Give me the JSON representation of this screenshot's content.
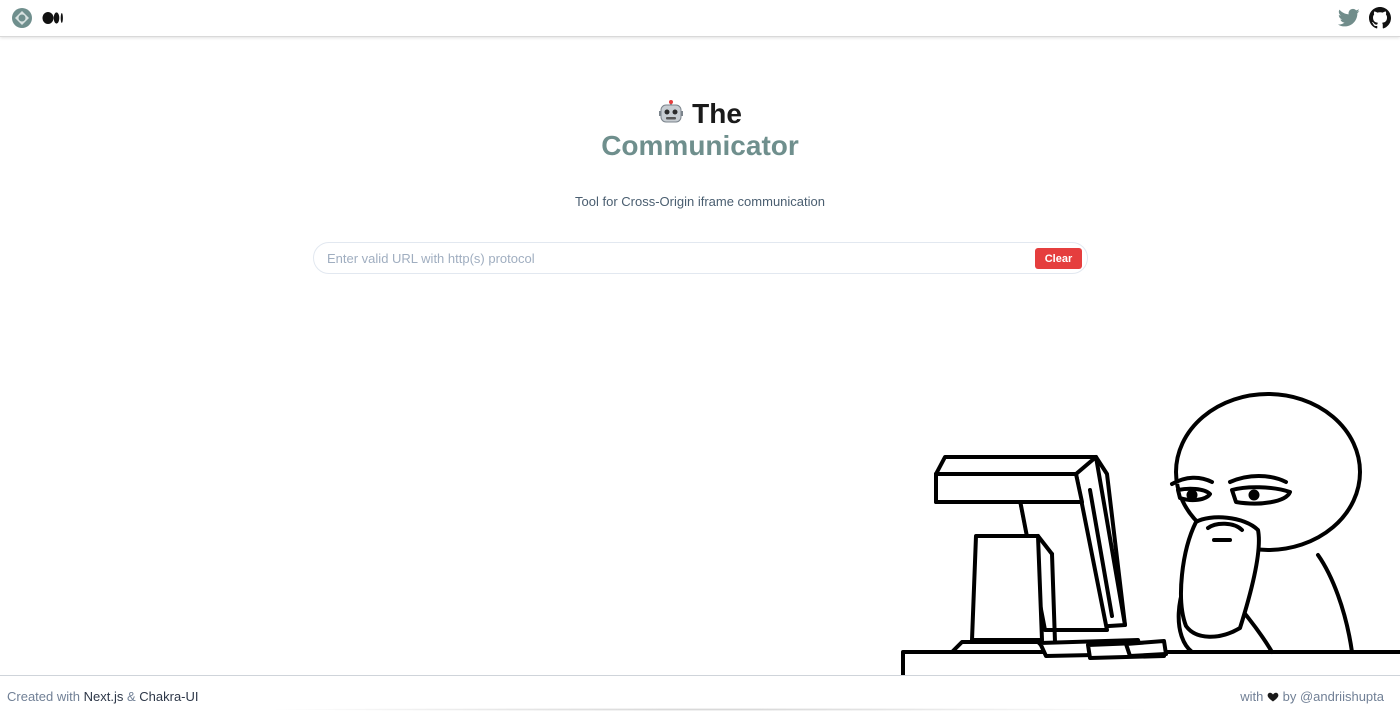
{
  "nav": {
    "left_icons": [
      "app-logo-icon",
      "medium-icon"
    ],
    "right_icons": [
      "twitter-icon",
      "github-icon"
    ],
    "twitter_color": "#718d8b",
    "github_color": "#111111"
  },
  "hero": {
    "title_emoji_icon": "robot-icon",
    "title_line_1": "The",
    "title_line_2": "Communicator",
    "accent_color": "#6f8f8d",
    "subtitle": "Tool for Cross-Origin iframe communication"
  },
  "url_form": {
    "placeholder": "Enter valid URL with http(s) protocol",
    "value": "",
    "clear_label": "Clear",
    "clear_color": "#e53e3e"
  },
  "footer": {
    "created_prefix": "Created with",
    "nextjs_label": "Next.js",
    "and_symbol": "&",
    "chakra_label": "Chakra-UI",
    "with_label": "with",
    "heart_icon": "heart-icon",
    "by_label": "by",
    "author_handle": "@andriishupta"
  }
}
